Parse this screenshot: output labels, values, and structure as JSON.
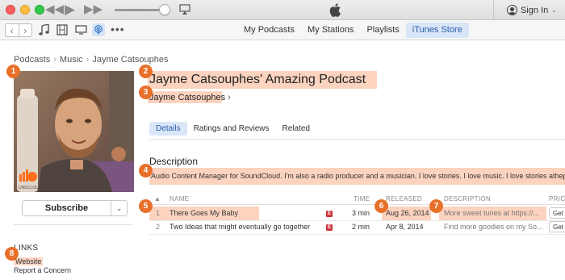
{
  "titlebar": {
    "signin_label": "Sign In"
  },
  "toolbar": {
    "more_label": "•••",
    "tabs": [
      {
        "label": "My Podcasts"
      },
      {
        "label": "My Stations"
      },
      {
        "label": "Playlists"
      },
      {
        "label": "iTunes Store"
      }
    ]
  },
  "breadcrumb": [
    "Podcasts",
    "Music",
    "Jayme Catsouphes"
  ],
  "podcast": {
    "title": "Jayme Catsouphes' Amazing Podcast",
    "author": "Jayme Catsouphes",
    "artwork_watermark": "UNDCLOUD"
  },
  "subscribe_label": "Subscribe",
  "subtabs": [
    {
      "label": "Details"
    },
    {
      "label": "Ratings and Reviews"
    },
    {
      "label": "Related"
    }
  ],
  "description": {
    "heading": "Description",
    "text": "Audio Content Manager for SoundCloud. I'm also a radio producer and a musician. I love stories. I love music. I love stories athepro"
  },
  "table": {
    "columns": {
      "sort_arrow": "▲",
      "name": "NAME",
      "time": "TIME",
      "released": "RELEASED",
      "description": "DESCRIPTION",
      "price": "PRIC"
    },
    "rows": [
      {
        "num": "1",
        "name": "There Goes My Baby",
        "explicit": "E",
        "time": "3 min",
        "released": "Aug 26, 2014",
        "description": "More sweet tunes at https://...",
        "price": "Get"
      },
      {
        "num": "2",
        "name": "Two Ideas that might eventually go together",
        "explicit": "E",
        "time": "2 min",
        "released": "Apr 8, 2014",
        "description": "Find more goodies on my So...",
        "price": "Get"
      }
    ]
  },
  "links": {
    "heading": "LINKS",
    "website": "Website",
    "report": "Report a Concern"
  },
  "markers": [
    "1",
    "2",
    "3",
    "4",
    "5",
    "6",
    "7",
    "8"
  ],
  "colors": {
    "highlight": "#fbd3bf",
    "marker": "#e8702a",
    "accent_tab": "#d9e6f8",
    "explicit": "#d0343c"
  }
}
